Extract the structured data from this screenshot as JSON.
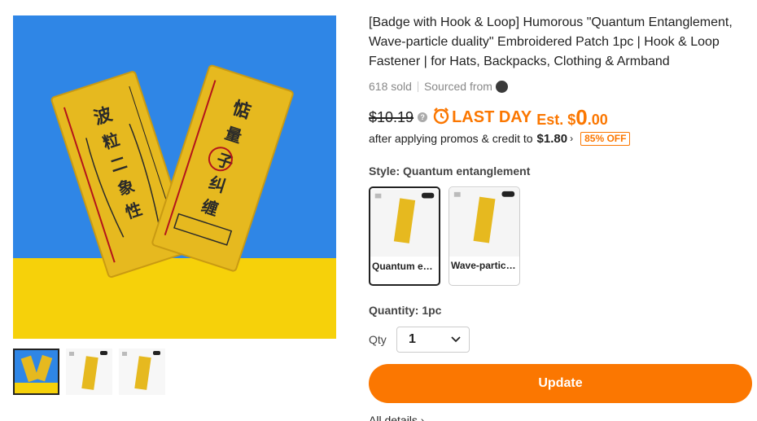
{
  "product": {
    "title": "[Badge with Hook & Loop] Humorous \"Quantum Entanglement, Wave-particle duality\" Embroidered Patch 1pc | Hook & Loop Fastener | for Hats, Backpacks, Clothing & Armband",
    "sold": "618 sold",
    "sourced_from": "Sourced from",
    "source_logo_icon": "brand-logo-icon"
  },
  "price": {
    "original": "$10.19",
    "help_icon": "question-icon",
    "clock_icon": "alarm-clock-icon",
    "last_day": "LAST DAY",
    "est_label": "Est. $",
    "est_whole": "0",
    "est_cents": ".00",
    "promo_text": "after applying promos & credit to",
    "promo_price": "$1.80",
    "promo_chevron": "›",
    "off_badge": "85% OFF",
    "accent_color": "#fb7701"
  },
  "style": {
    "label": "Style:",
    "selected": "Quantum entanglement",
    "options": [
      {
        "label": "Quantum entangleme...",
        "badge": "1pc",
        "selected": true
      },
      {
        "label": "Wave-particle...",
        "badge": "1pc",
        "selected": false
      }
    ]
  },
  "quantity": {
    "label": "Quantity:",
    "selected": "1pc",
    "qty_text": "Qty",
    "qty_value": "1"
  },
  "actions": {
    "update": "Update",
    "all_details": "All details ›"
  }
}
